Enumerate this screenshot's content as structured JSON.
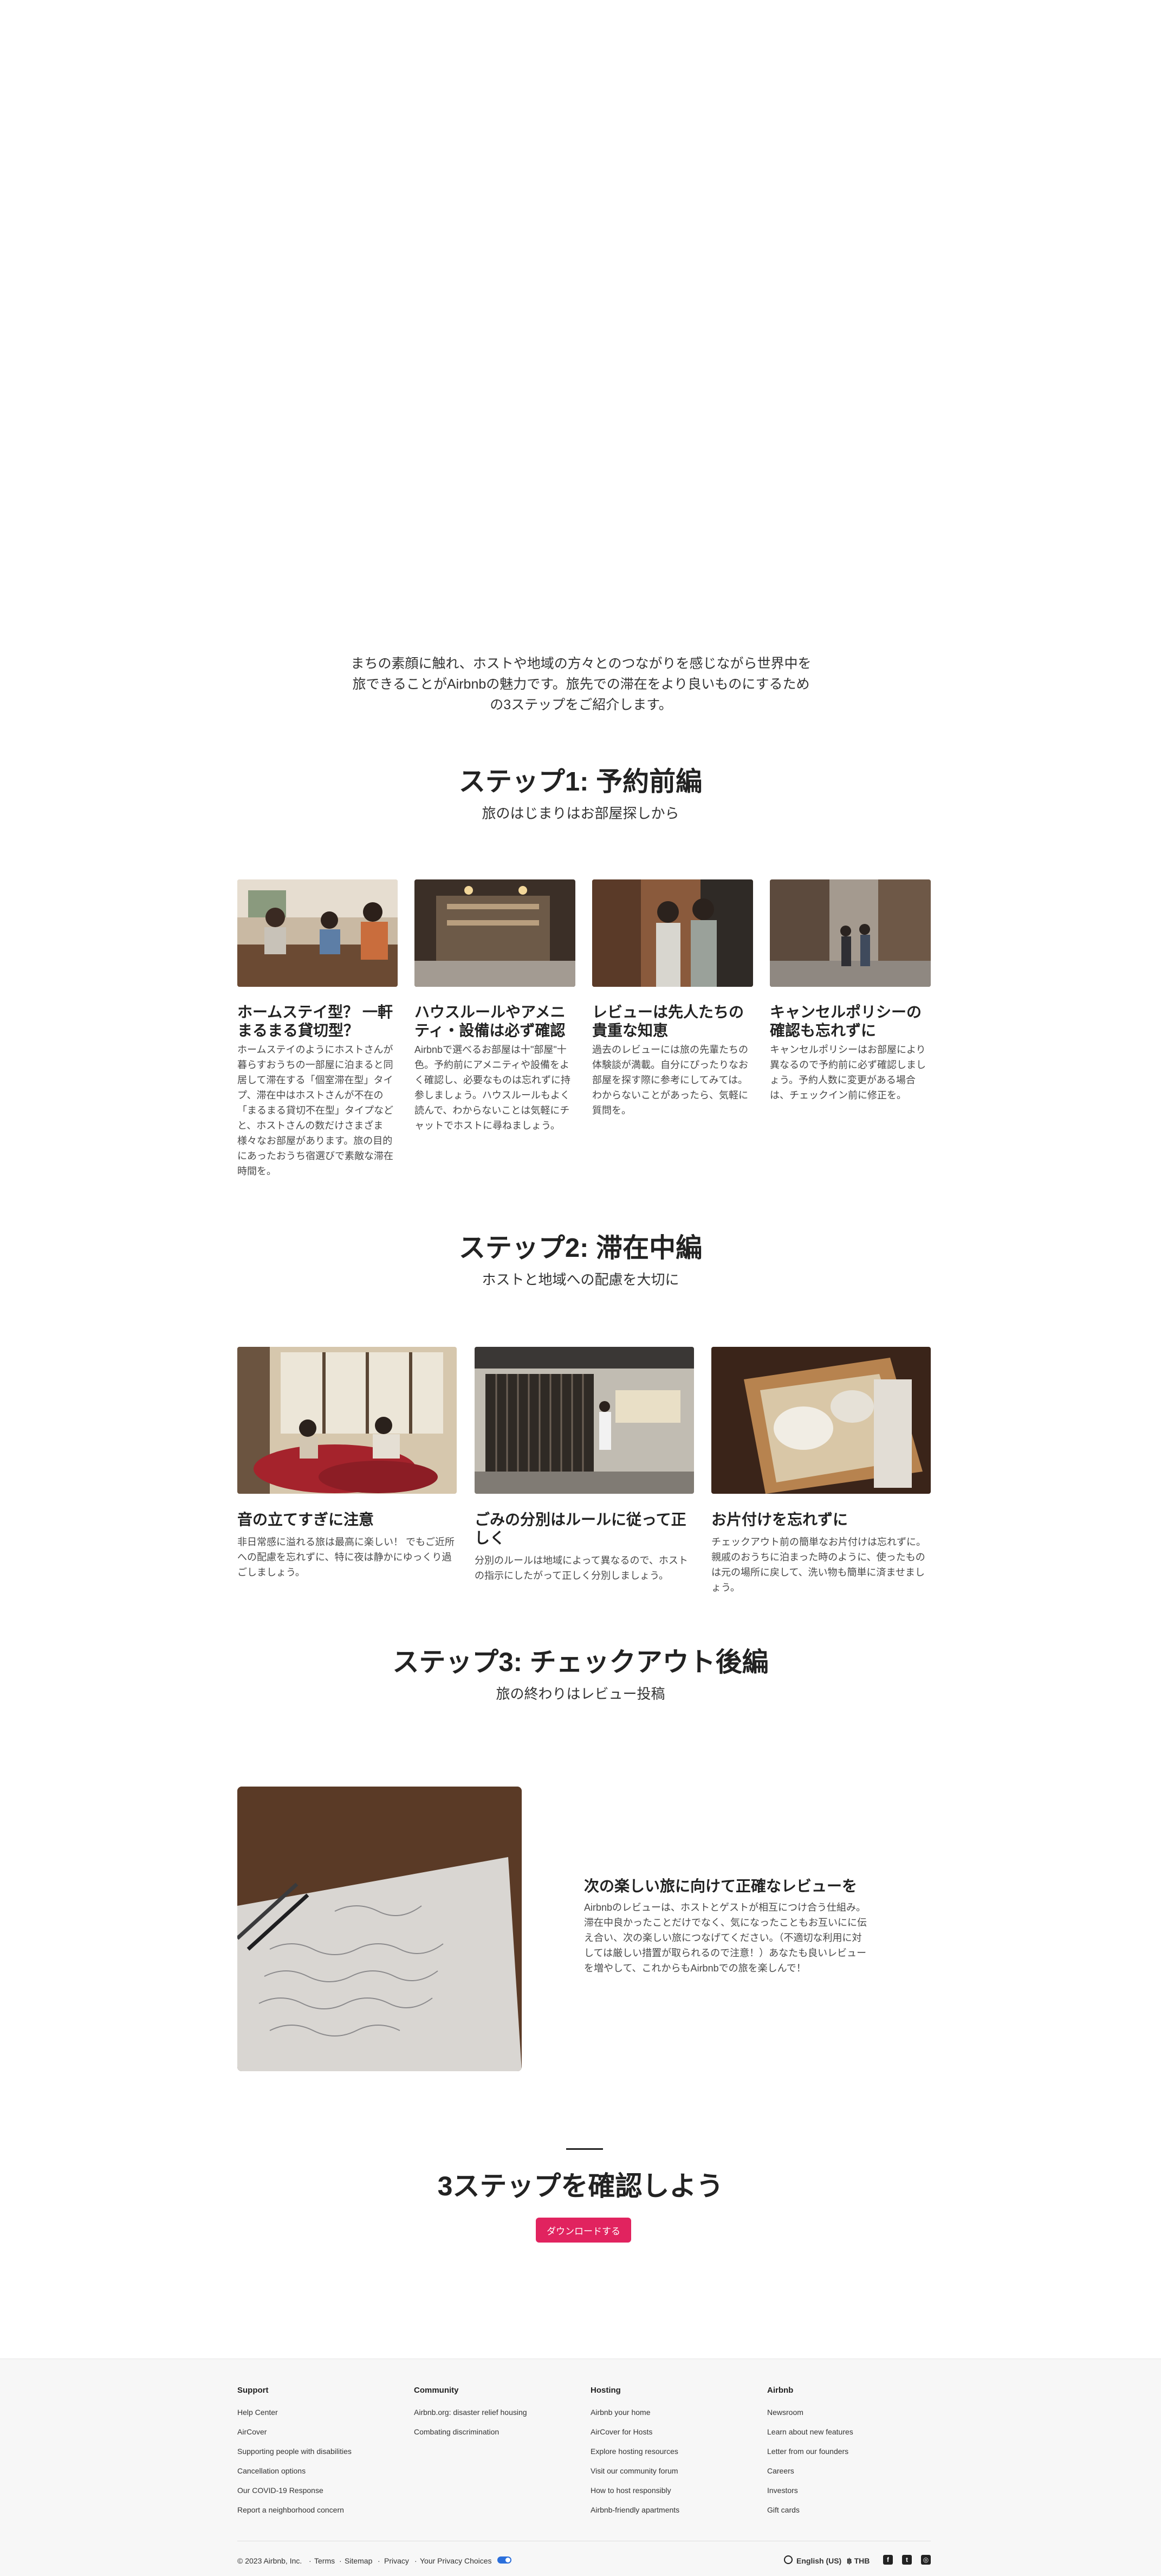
{
  "intro": "まちの素顔に触れ、ホストや地域の方々とのつながりを感じながら世界中を旅できることがAirbnbの魅力です。旅先での滞在をより良いものにするための3ステップをご紹介します。",
  "step1": {
    "title": "ステップ1: 予約前編",
    "subtitle": "旅のはじまりはお部屋探しから",
    "cards": [
      {
        "title": "ホームステイ型？ 一軒まるまる貸切型？",
        "text": "ホームステイのようにホストさんが暮らすおうちの一部屋に泊まると同居して滞在する「個室滞在型」タイプ、滞在中はホストさんが不在の「まるまる貸切不在型」タイプなどと、ホストさんの数だけさまざま様々なお部屋があります。旅の目的にあったおうち宿選びで素敵な滞在時間を。"
      },
      {
        "title": "ハウスルールやアメニティ・設備は必ず確認",
        "text": "Airbnbで選べるお部屋は十\"部屋\"十色。予約前にアメニティや設備をよく確認し、必要なものは忘れずに持参しましょう。ハウスルールもよく読んで、わからないことは気軽にチャットでホストに尋ねましょう。"
      },
      {
        "title": "レビューは先人たちの貴重な知恵",
        "text": "過去のレビューには旅の先輩たちの体験談が満載。自分にぴったりなお部屋を探す際に参考にしてみては。わからないことがあったら、気軽に質問を。"
      },
      {
        "title": "キャンセルポリシーの確認も忘れずに",
        "text": "キャンセルポリシーはお部屋により異なるので予約前に必ず確認しましょう。予約人数に変更がある場合は、チェックイン前に修正を。"
      }
    ]
  },
  "step2": {
    "title": "ステップ2: 滞在中編",
    "subtitle": "ホストと地域への配慮を大切に",
    "cards": [
      {
        "title": "音の立てすぎに注意",
        "text": "非日常感に溢れる旅は最高に楽しい！ でもご近所への配慮を忘れずに、特に夜は静かにゆっくり過ごしましょう。"
      },
      {
        "title": "ごみの分別はルールに従って正しく",
        "text": "分別のルールは地域によって異なるので、ホストの指示にしたがって正しく分別しましょう。"
      },
      {
        "title": "お片付けを忘れずに",
        "text": "チェックアウト前の簡単なお片付けは忘れずに。親戚のおうちに泊まった時のように、使ったものは元の場所に戻して、洗い物も簡単に済ませましょう。"
      }
    ]
  },
  "step3": {
    "title": "ステップ3: チェックアウト後編",
    "subtitle": "旅の終わりはレビュー投稿",
    "card": {
      "title": "次の楽しい旅に向けて正確なレビューを",
      "text": "Airbnbのレビューは、ホストとゲストが相互につけ合う仕組み。滞在中良かったことだけでなく、気になったこともお互いにに伝え合い、次の楽しい旅につなげてください。（不適切な利用に対しては厳しい措置が取られるので注意！）あなたも良いレビューを増やして、これからもAirbnbでの旅を楽しんで！"
    }
  },
  "cta": {
    "title": "3ステップを確認しよう",
    "button": "ダウンロードする"
  },
  "footer": {
    "columns": [
      {
        "heading": "Support",
        "links": [
          "Help Center",
          "AirCover",
          "Supporting people with disabilities",
          "Cancellation options",
          "Our COVID-19 Response",
          "Report a neighborhood concern"
        ]
      },
      {
        "heading": "Community",
        "links": [
          "Airbnb.org: disaster relief housing",
          "Combating discrimination"
        ]
      },
      {
        "heading": "Hosting",
        "links": [
          "Airbnb your home",
          "AirCover for Hosts",
          "Explore hosting resources",
          "Visit our community forum",
          "How to host responsibly",
          "Airbnb-friendly apartments"
        ]
      },
      {
        "heading": "Airbnb",
        "links": [
          "Newsroom",
          "Learn about new features",
          "Letter from our founders",
          "Careers",
          "Investors",
          "Gift cards"
        ]
      }
    ],
    "copyright": "© 2023 Airbnb, Inc.",
    "legal": [
      "Terms",
      "Sitemap",
      "Privacy",
      "Your Privacy Choices"
    ],
    "language": "English (US)",
    "currency": "฿ THB"
  }
}
